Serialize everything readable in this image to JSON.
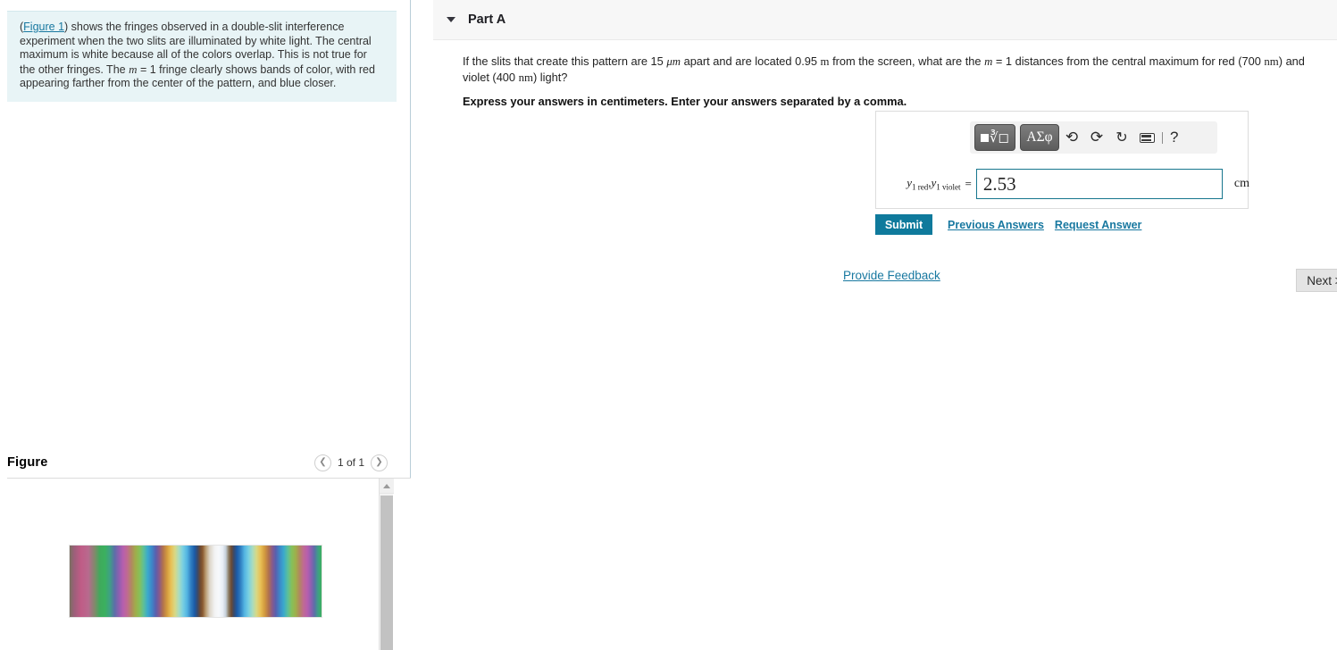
{
  "left_panel": {
    "intro": {
      "figure_link": "Figure 1",
      "text_before": "(",
      "text_after_link": ") shows the fringes observed in a double-slit interference experiment when the two slits are illuminated by white light. The central maximum is white because all of the colors overlap. This is not true for the other fringes. The ",
      "m_symbol": "m",
      "text_tail": " = 1 fringe clearly shows bands of color, with red appearing farther from the center of the pattern, and blue closer."
    },
    "figure": {
      "title": "Figure",
      "page_indicator": "1 of 1",
      "prev_icon": "chevron-left-icon",
      "next_icon": "chevron-right-icon",
      "image_alt": "double-slit white-light interference fringe pattern"
    }
  },
  "right_panel": {
    "part": {
      "caret_icon": "caret-down-icon",
      "title": "Part A"
    },
    "question": {
      "seg1": "If the slits that create this pattern are 15 ",
      "mu_m": "μm",
      "seg2": " apart and are located 0.95 ",
      "unit_m": "m",
      "seg3": " from the screen, what are the ",
      "m_symbol": "m",
      "seg4": " = 1 distances from the central maximum for red (700 ",
      "unit_nm_1": "nm",
      "seg5": ") and violet (400 ",
      "unit_nm_2": "nm",
      "seg6": ") light?",
      "instruction": "Express your answers in centimeters. Enter your answers separated by a comma."
    },
    "math_toolbar": {
      "template_button_label": "template-radical",
      "greek_button_label": "ΑΣφ",
      "undo_icon": "undo-arrow-icon",
      "redo_icon": "redo-arrow-icon",
      "reset_icon": "refresh-icon",
      "keyboard_icon": "keyboard-icon",
      "help_label": "?"
    },
    "answer": {
      "label_y1": "y",
      "label_sub_red": "1 red",
      "label_comma": ",",
      "label_sub_violet": "1 violet",
      "equals": "=",
      "value": "2.53",
      "placeholder": "",
      "unit": "cm"
    },
    "actions": {
      "submit_label": "Submit",
      "previous_answers_label": "Previous Answers",
      "request_answer_label": "Request Answer",
      "provide_feedback_label": "Provide Feedback",
      "next_label": "Next >"
    }
  },
  "colors": {
    "accent_teal": "#0f7a9c",
    "link_blue": "#1878a0",
    "info_bg": "#e8f4f6",
    "header_bg": "#f7f7f7",
    "input_border": "#17768e"
  }
}
